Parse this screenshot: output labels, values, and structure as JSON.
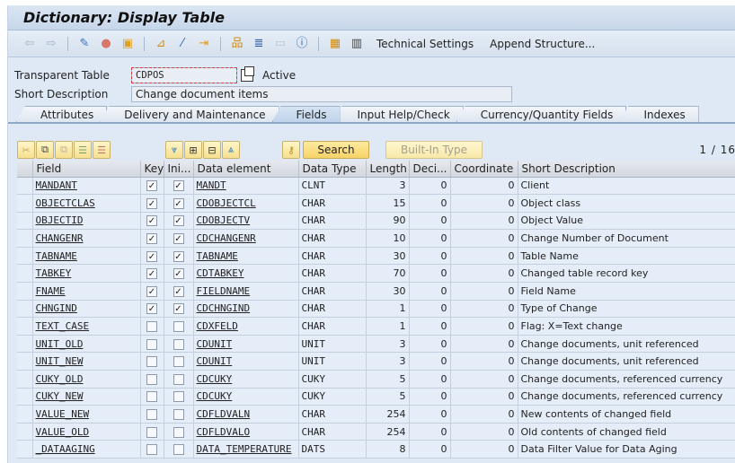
{
  "window": {
    "title": "Dictionary: Display Table"
  },
  "toolbar": {
    "icons": [
      "back-icon",
      "forward-icon",
      "display-change-icon",
      "other-object-icon",
      "object-list-icon",
      "where-used-icon",
      "activate-icon",
      "navigate-icon",
      "hierarchy-icon",
      "align-icon",
      "layout-icon",
      "info-icon",
      "structure-icon",
      "columns-icon"
    ],
    "technical_settings": "Technical Settings",
    "append_structure": "Append Structure..."
  },
  "header": {
    "table_label": "Transparent Table",
    "table_value": "CDPOS",
    "status": "Active",
    "desc_label": "Short Description",
    "desc_value": "Change document items"
  },
  "tabs": [
    {
      "label": "Attributes",
      "active": false
    },
    {
      "label": "Delivery and Maintenance",
      "active": false
    },
    {
      "label": "Fields",
      "active": true
    },
    {
      "label": "Input Help/Check",
      "active": false
    },
    {
      "label": "Currency/Quantity Fields",
      "active": false
    },
    {
      "label": "Indexes",
      "active": false
    }
  ],
  "grid_toolbar": {
    "search": "Search",
    "builtin_type": "Built-In Type",
    "pager": "1 / 16"
  },
  "columns": [
    "Field",
    "Key",
    "Ini...",
    "Data element",
    "Data Type",
    "Length",
    "Deci...",
    "Coordinate",
    "Short Description"
  ],
  "rows": [
    {
      "field": "MANDANT",
      "key": true,
      "ini": true,
      "element": "MANDT",
      "type": "CLNT",
      "length": "3",
      "dec": "0",
      "coord": "0",
      "desc": "Client"
    },
    {
      "field": "OBJECTCLAS",
      "key": true,
      "ini": true,
      "element": "CDOBJECTCL",
      "type": "CHAR",
      "length": "15",
      "dec": "0",
      "coord": "0",
      "desc": "Object class"
    },
    {
      "field": "OBJECTID",
      "key": true,
      "ini": true,
      "element": "CDOBJECTV",
      "type": "CHAR",
      "length": "90",
      "dec": "0",
      "coord": "0",
      "desc": "Object Value"
    },
    {
      "field": "CHANGENR",
      "key": true,
      "ini": true,
      "element": "CDCHANGENR",
      "type": "CHAR",
      "length": "10",
      "dec": "0",
      "coord": "0",
      "desc": "Change Number of Document"
    },
    {
      "field": "TABNAME",
      "key": true,
      "ini": true,
      "element": "TABNAME",
      "type": "CHAR",
      "length": "30",
      "dec": "0",
      "coord": "0",
      "desc": "Table Name"
    },
    {
      "field": "TABKEY",
      "key": true,
      "ini": true,
      "element": "CDTABKEY",
      "type": "CHAR",
      "length": "70",
      "dec": "0",
      "coord": "0",
      "desc": "Changed table record key"
    },
    {
      "field": "FNAME",
      "key": true,
      "ini": true,
      "element": "FIELDNAME",
      "type": "CHAR",
      "length": "30",
      "dec": "0",
      "coord": "0",
      "desc": "Field Name"
    },
    {
      "field": "CHNGIND",
      "key": true,
      "ini": true,
      "element": "CDCHNGIND",
      "type": "CHAR",
      "length": "1",
      "dec": "0",
      "coord": "0",
      "desc": "Type of Change"
    },
    {
      "field": "TEXT_CASE",
      "key": false,
      "ini": false,
      "element": "CDXFELD",
      "type": "CHAR",
      "length": "1",
      "dec": "0",
      "coord": "0",
      "desc": "Flag: X=Text change"
    },
    {
      "field": "UNIT_OLD",
      "key": false,
      "ini": false,
      "element": "CDUNIT",
      "type": "UNIT",
      "length": "3",
      "dec": "0",
      "coord": "0",
      "desc": "Change documents, unit referenced"
    },
    {
      "field": "UNIT_NEW",
      "key": false,
      "ini": false,
      "element": "CDUNIT",
      "type": "UNIT",
      "length": "3",
      "dec": "0",
      "coord": "0",
      "desc": "Change documents, unit referenced"
    },
    {
      "field": "CUKY_OLD",
      "key": false,
      "ini": false,
      "element": "CDCUKY",
      "type": "CUKY",
      "length": "5",
      "dec": "0",
      "coord": "0",
      "desc": "Change documents, referenced currency"
    },
    {
      "field": "CUKY_NEW",
      "key": false,
      "ini": false,
      "element": "CDCUKY",
      "type": "CUKY",
      "length": "5",
      "dec": "0",
      "coord": "0",
      "desc": "Change documents, referenced currency"
    },
    {
      "field": "VALUE_NEW",
      "key": false,
      "ini": false,
      "element": "CDFLDVALN",
      "type": "CHAR",
      "length": "254",
      "dec": "0",
      "coord": "0",
      "desc": "New contents of changed field"
    },
    {
      "field": "VALUE_OLD",
      "key": false,
      "ini": false,
      "element": "CDFLDVALO",
      "type": "CHAR",
      "length": "254",
      "dec": "0",
      "coord": "0",
      "desc": "Old contents of changed field"
    },
    {
      "field": "_DATAAGING",
      "key": false,
      "ini": false,
      "element": "DATA_TEMPERATURE",
      "type": "DATS",
      "length": "8",
      "dec": "0",
      "coord": "0",
      "desc": "Data Filter Value for Data Aging"
    }
  ]
}
